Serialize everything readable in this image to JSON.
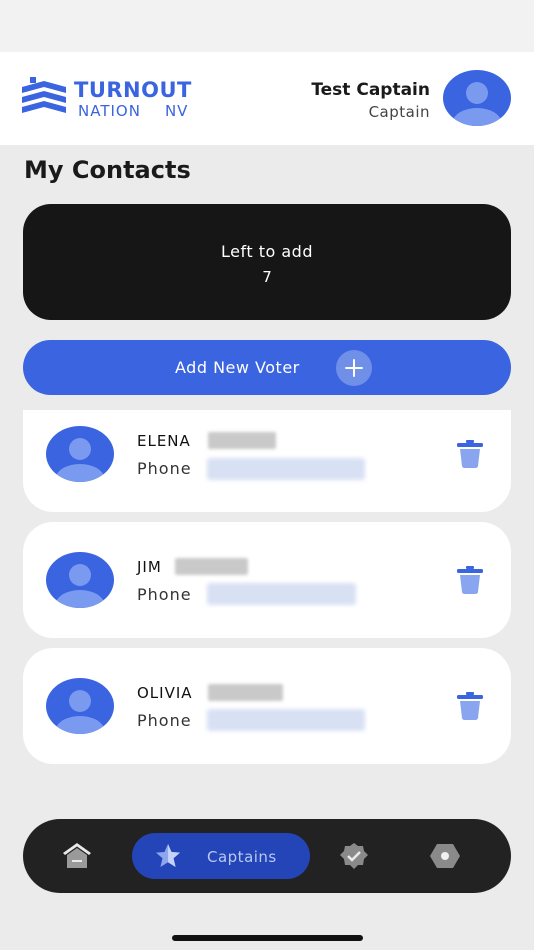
{
  "brand": {
    "line1": "TURNOUT",
    "line2": "NATION",
    "line3": "NV",
    "color": "#3a64e0"
  },
  "user": {
    "name": "Test Captain",
    "role": "Captain"
  },
  "page": {
    "title": "My Contacts"
  },
  "counter": {
    "label": "Left to add",
    "value": "7"
  },
  "actions": {
    "add_voter_label": "Add New Voter"
  },
  "contacts": [
    {
      "first_name": "ELENA",
      "phone_label": "Phone"
    },
    {
      "first_name": "JIM",
      "phone_label": "Phone"
    },
    {
      "first_name": "OLIVIA",
      "phone_label": "Phone"
    }
  ],
  "nav": {
    "items": [
      {
        "icon": "home-icon"
      },
      {
        "icon": "star-icon",
        "label": "Captains",
        "active": true
      },
      {
        "icon": "badge-check-icon"
      },
      {
        "icon": "settings-hex-icon"
      }
    ]
  },
  "colors": {
    "accent": "#3a64e0",
    "dark": "#161616",
    "nav_active": "#2345b8",
    "background": "#ecebec"
  }
}
